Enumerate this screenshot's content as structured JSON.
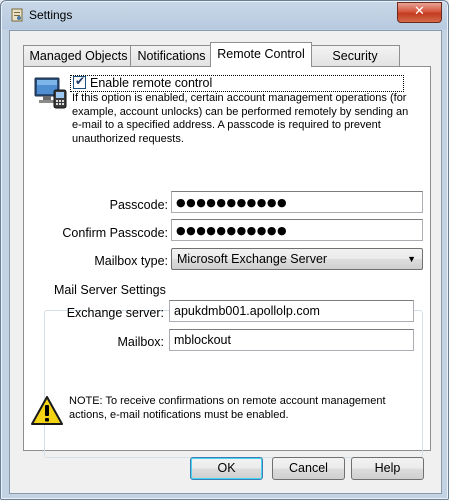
{
  "window": {
    "title": "Settings"
  },
  "tabs": [
    {
      "label": "Managed Objects",
      "active": false
    },
    {
      "label": "Notifications",
      "active": false
    },
    {
      "label": "Remote Control",
      "active": true
    },
    {
      "label": "Security Roles",
      "active": false
    }
  ],
  "remote": {
    "checkbox_label": "Enable remote control",
    "checked": true,
    "description": "If this option is enabled, certain account management operations (for example, account unlocks) can be performed remotely by sending an e-mail to a specified address.  A passcode is required to prevent unauthorized requests."
  },
  "fields": {
    "passcode_label": "Passcode:",
    "passcode_value": "●●●●●●●●●●●",
    "confirm_label": "Confirm Passcode:",
    "confirm_value": "●●●●●●●●●●●",
    "mailbox_type_label": "Mailbox type:",
    "mailbox_type_value": "Microsoft Exchange Server"
  },
  "mail_server": {
    "group_title": "Mail Server Settings",
    "exchange_label": "Exchange server:",
    "exchange_value": "apukdmb001.apollolp.com",
    "mailbox_label": "Mailbox:",
    "mailbox_value": "mblockout"
  },
  "note": "NOTE: To receive confirmations on remote account management actions, e-mail notifications must be enabled.",
  "buttons": {
    "ok": "OK",
    "cancel": "Cancel",
    "help": "Help"
  },
  "colors": {
    "titlebar": "#b7cadf",
    "close": "#c23b1f",
    "panel": "#ffffff"
  }
}
